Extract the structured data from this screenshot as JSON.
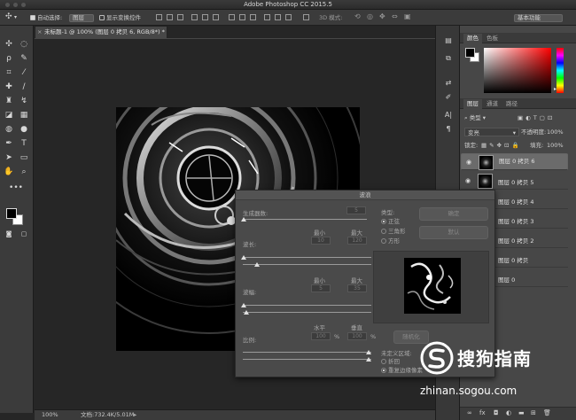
{
  "window": {
    "title": "Adobe Photoshop CC 2015.5"
  },
  "options_bar": {
    "auto_select_label": "自动选择:",
    "auto_select_value": "图层",
    "show_transform_label": "显示变换控件",
    "mode_3d_label": "3D 模式:",
    "workspace": "基本功能"
  },
  "document": {
    "tab_title": "未标题-1 @ 100% (图层 0 拷贝 6, RGB/8*) *",
    "zoom": "100%",
    "doc_size": "文档:732.4K/5.01M"
  },
  "color_panel": {
    "tabs": [
      "颜色",
      "色板"
    ],
    "active_tab": 0,
    "hue_color": "#ff0000"
  },
  "layers_panel": {
    "tabs": [
      "图层",
      "通道",
      "路径"
    ],
    "active_tab": 0,
    "filter_type": "类型",
    "blend_mode": "变亮",
    "opacity_label": "不透明度:",
    "opacity_value": "100%",
    "lock_label": "锁定:",
    "fill_label": "填充:",
    "fill_value": "100%",
    "layers": [
      {
        "name": "图层 0 拷贝 6",
        "selected": true
      },
      {
        "name": "图层 0 拷贝 5",
        "selected": false
      },
      {
        "name": "图层 0 拷贝 4",
        "selected": false
      },
      {
        "name": "图层 0 拷贝 3",
        "selected": false
      },
      {
        "name": "图层 0 拷贝 2",
        "selected": false
      },
      {
        "name": "图层 0 拷贝",
        "selected": false
      },
      {
        "name": "图层 0",
        "selected": false
      }
    ]
  },
  "wave_dialog": {
    "title": "波浪",
    "generators_label": "生成器数:",
    "generators_value": "5",
    "wavelength_label": "波长:",
    "amplitude_label": "波幅:",
    "scale_label": "比例:",
    "min_label": "最小",
    "max_label": "最大",
    "horizontal_label": "水平",
    "vertical_label": "垂直",
    "wavelength_min": "10",
    "wavelength_max": "120",
    "amplitude_min": "5",
    "amplitude_max": "35",
    "scale_h": "100",
    "scale_v": "100",
    "percent": "%",
    "type_label": "类型:",
    "types": [
      "正弦",
      "三角形",
      "方形"
    ],
    "ok_label": "确定",
    "default_label": "默认",
    "randomize_label": "随机化",
    "undefined_label": "未定义区域:",
    "undefined_options": [
      "折回",
      "重复边缘像素"
    ]
  },
  "watermark": {
    "brand": "搜狗指南",
    "url": "zhinan.sogou.com"
  }
}
